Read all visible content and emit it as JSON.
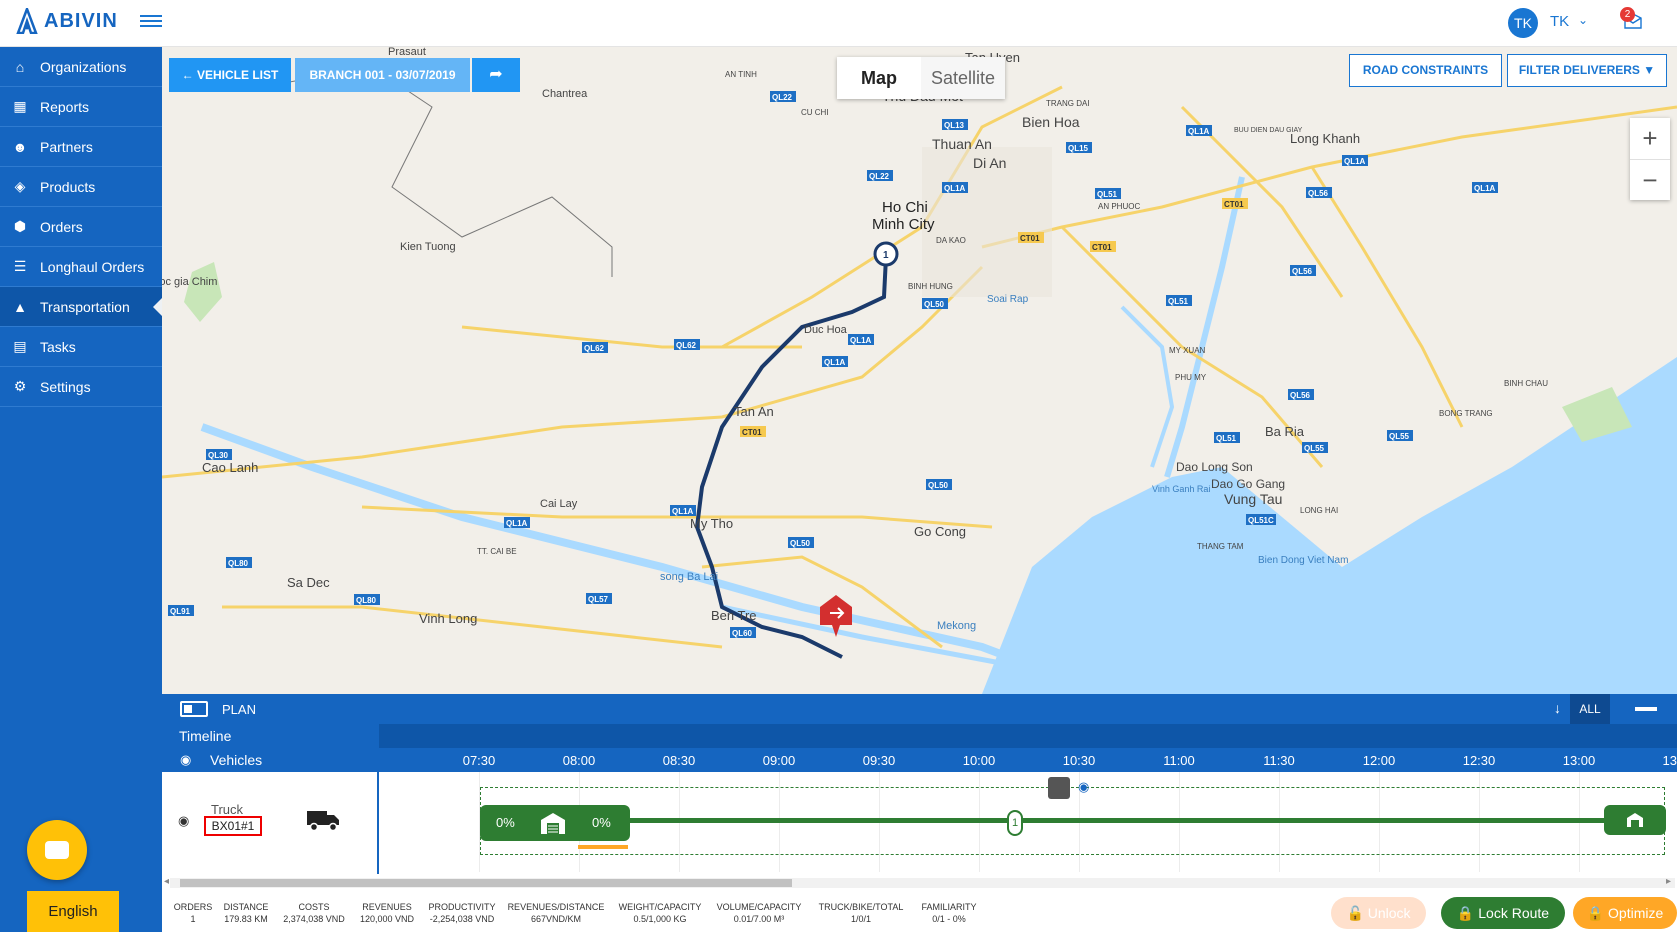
{
  "brand": {
    "name": "ABIVIN"
  },
  "user": {
    "initials": "TK",
    "name": "TK",
    "notification_count": "2"
  },
  "sidebar": {
    "items": [
      {
        "label": "Organizations",
        "icon": "home-icon"
      },
      {
        "label": "Reports",
        "icon": "bar-chart-icon"
      },
      {
        "label": "Partners",
        "icon": "users-icon"
      },
      {
        "label": "Products",
        "icon": "boxes-icon"
      },
      {
        "label": "Orders",
        "icon": "cubes-icon"
      },
      {
        "label": "Longhaul Orders",
        "icon": "list-icon"
      },
      {
        "label": "Transportation",
        "icon": "road-icon",
        "active": true
      },
      {
        "label": "Tasks",
        "icon": "calendar-icon"
      },
      {
        "label": "Settings",
        "icon": "gear-icon"
      }
    ],
    "language": "English"
  },
  "map": {
    "vehicle_list_label": "← VEHICLE LIST",
    "branch_label": "BRANCH 001 - 03/07/2019",
    "share_icon": "share-icon",
    "map_tab": "Map",
    "satellite_tab": "Satellite",
    "road_constraints_label": "ROAD CONSTRAINTS",
    "filter_deliverers_label": "FILTER DELIVERERS",
    "zoom_in": "+",
    "zoom_out": "−",
    "place_labels": [
      "Prasaut",
      "Chantrea",
      "AN TINH",
      "CU CHI",
      "Tan Uyen",
      "Thu Dau Mot",
      "TRANG DAI",
      "Bien Hoa",
      "Thuan An",
      "Di An",
      "BUU DIEN DAU GIAY",
      "Long Khanh",
      "Ho Chi",
      "Minh City",
      "DA KAO",
      "AN PHUOC",
      "Kien Tuong",
      "BINH HUNG",
      "Soai Rap",
      "Duc Hoa",
      "Tan An",
      "MY XUAN",
      "PHU MY",
      "BINH CHAU",
      "BONG TRANG",
      "Ba Ria",
      "Cao Lanh",
      "Cai Lay",
      "My Tho",
      "Go Cong",
      "Dao Long Son",
      "Dao Go Gang",
      "Vung Tau",
      "Vinh Ganh Rai",
      "LONG HAI",
      "THANG TAM",
      "Bien Dong Viet Nam",
      "TT. CAI BE",
      "song Ba Lai",
      "Sa Dec",
      "Vinh Long",
      "Ben Tre",
      "Mekong",
      "Soc gia Chim"
    ],
    "route_stop_label": "1",
    "road_shields": [
      "QL22",
      "QL13",
      "QL1A",
      "QL15",
      "QL1A",
      "QL1A",
      "QL56",
      "QL22",
      "QL1A",
      "QL51",
      "CT01",
      "CT01",
      "CT01",
      "QL56",
      "QL50",
      "QL51",
      "QL1A",
      "QL62",
      "QL62",
      "QL1A",
      "QL56",
      "CT01",
      "QL51",
      "QL55",
      "QL55",
      "QL30",
      "QL1A",
      "QL50",
      "QL1A",
      "QL50",
      "QL80",
      "QL57",
      "QL80",
      "QL91",
      "QL60",
      "QL51C"
    ]
  },
  "plan": {
    "title": "PLAN",
    "all_label": "ALL",
    "timeline_label": "Timeline",
    "vehicles_label": "Vehicles",
    "times": [
      "07:30",
      "08:00",
      "08:30",
      "09:00",
      "09:30",
      "10:00",
      "10:30",
      "11:00",
      "11:30",
      "12:00",
      "12:30",
      "13:00",
      "13"
    ],
    "vehicle": {
      "type": "Truck",
      "id": "BX01#1",
      "depot_start_pct": "0%",
      "depot_end_pct": "0%",
      "stop_label": "1"
    }
  },
  "stats": [
    {
      "label": "ORDERS",
      "value": "1"
    },
    {
      "label": "DISTANCE",
      "value": "179.83 KM"
    },
    {
      "label": "COSTS",
      "value": "2,374,038 VND"
    },
    {
      "label": "REVENUES",
      "value": "120,000 VND"
    },
    {
      "label": "PRODUCTIVITY",
      "value": "-2,254,038 VND"
    },
    {
      "label": "REVENUES/DISTANCE",
      "value": "667VND/KM"
    },
    {
      "label": "WEIGHT/CAPACITY",
      "value": "0.5/1,000 KG"
    },
    {
      "label": "VOLUME/CAPACITY",
      "value": "0.01/7.00 M³"
    },
    {
      "label": "TRUCK/BIKE/TOTAL",
      "value": "1/0/1"
    },
    {
      "label": "FAMILIARITY",
      "value": "0/1 - 0%"
    }
  ],
  "actions": {
    "unlock_label": "Unlock",
    "lock_route_label": "Lock Route",
    "optimize_label": "Optimize"
  },
  "colors": {
    "primary": "#1565c0",
    "accent": "#2196f3",
    "route": "#1b3a6b",
    "success": "#2e7d32",
    "warning": "#ffa726",
    "danger": "#e53935"
  }
}
